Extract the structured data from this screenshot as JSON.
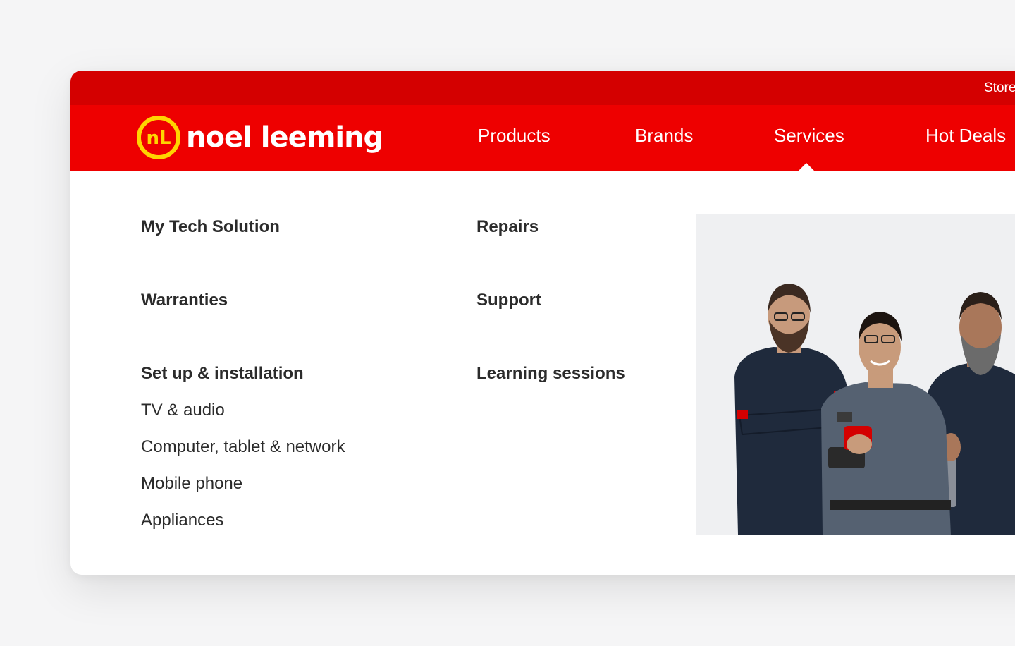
{
  "utility_bar": {
    "store_link": "Store"
  },
  "header": {
    "logo_text": "noel leeming",
    "logo_mark": "nL",
    "nav": {
      "products": "Products",
      "brands": "Brands",
      "services": "Services",
      "hot_deals": "Hot Deals"
    },
    "active_nav": "Services"
  },
  "services_menu": {
    "col1": {
      "my_tech_solution": "My Tech Solution",
      "warranties": "Warranties",
      "setup_installation": "Set up & installation",
      "setup_items": [
        "TV & audio",
        "Computer, tablet & network",
        "Mobile phone",
        "Appliances"
      ]
    },
    "col2": {
      "repairs": "Repairs",
      "support": "Support",
      "learning_sessions": "Learning sessions"
    }
  },
  "promo_image": {
    "icon": "tech-team-photo"
  },
  "colors": {
    "brand_red": "#ee0000",
    "utility_red": "#d40000",
    "logo_yellow": "#ffd400",
    "text_dark": "#2b2b2b"
  }
}
